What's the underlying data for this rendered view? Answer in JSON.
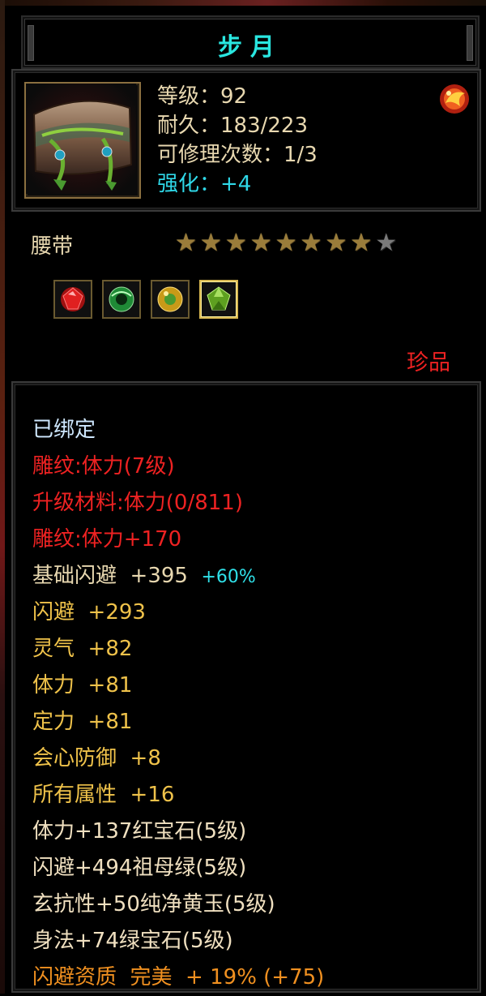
{
  "item": {
    "name": "步月",
    "level_text": "等级：92",
    "durability_text": "耐久：183/223",
    "repair_text": "可修理次数：1/3",
    "enhance_text": "强化：+4",
    "type": "腰带",
    "stars_total": 9,
    "stars_filled": 8,
    "rarity": "珍品",
    "icon": "belt-icon",
    "corner_icon": "fire-orb-icon"
  },
  "gems": [
    {
      "name": "ruby-gem-icon",
      "color": "#d02020"
    },
    {
      "name": "emerald-ring-icon",
      "color": "#2a9a40"
    },
    {
      "name": "yellow-jade-icon",
      "color": "#d0a020"
    },
    {
      "name": "green-gem-icon",
      "color": "#7ac030"
    }
  ],
  "attributes": {
    "bound": "已绑定",
    "engrave": "雕纹:体力(7级)",
    "upgrade_material": "升级材料:体力(0/811)",
    "engrave_bonus": "雕纹:体力+170",
    "base_dodge": "基础闪避  +395",
    "base_dodge_bonus": "+60%",
    "dodge": "闪避  +293",
    "aura": "灵气  +82",
    "stamina": "体力  +81",
    "concentration": "定力  +81",
    "crit_defense": "会心防御  +8",
    "all_attributes": "所有属性  +16",
    "gem1": "体力+137红宝石(5级)",
    "gem2": "闪避+494祖母绿(5级)",
    "gem3": "玄抗性+50纯净黄玉(5级)",
    "gem4": "身法+74绿宝石(5级)",
    "quality": "闪避资质  完美  + 19% (+75)"
  },
  "colors": {
    "title": "#29e6e0",
    "red": "#ee2222",
    "gold": "#efc24a",
    "cyan": "#2fe0e8",
    "orange": "#f09020"
  }
}
